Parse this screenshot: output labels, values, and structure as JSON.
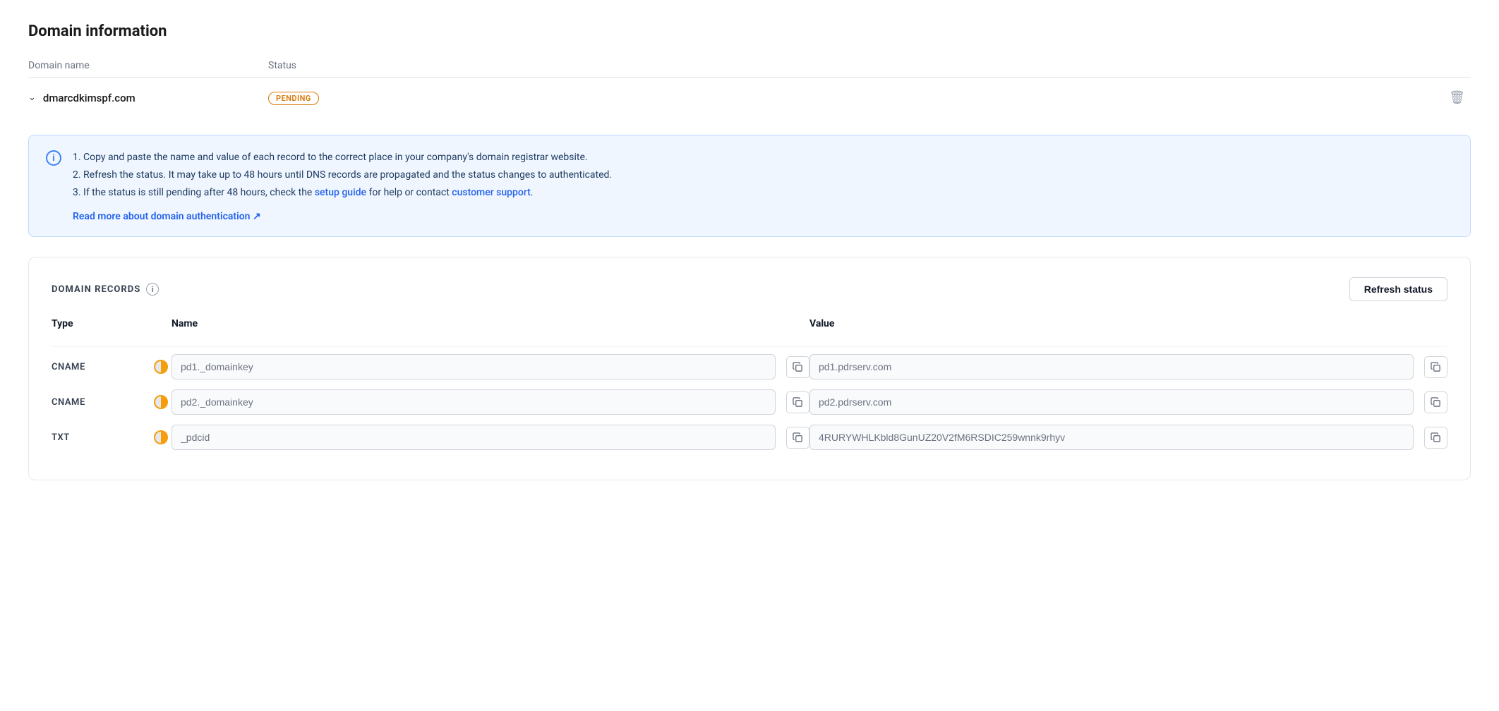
{
  "page": {
    "title": "Domain information"
  },
  "domain_table": {
    "col_name": "Domain name",
    "col_status": "Status",
    "domain": "dmarcdkimspf.com",
    "status": "PENDING"
  },
  "info_box": {
    "line1": "1. Copy and paste the name and value of each record to the correct place in your company's domain registrar website.",
    "line2": "2. Refresh the status. It may take up to 48 hours until DNS records are propagated and the status changes to authenticated.",
    "line3_pre": "3. If the status is still pending after 48 hours, check the ",
    "line3_link1": "setup guide",
    "line3_mid": " for help or contact ",
    "line3_link2": "customer support",
    "line3_post": ".",
    "read_more": "Read more about domain authentication ↗"
  },
  "domain_records": {
    "section_title": "DOMAIN RECORDS",
    "refresh_button": "Refresh status",
    "col_type": "Type",
    "col_name": "Name",
    "col_value": "Value",
    "records": [
      {
        "type": "CNAME",
        "name": "pd1._domainkey",
        "value": "pd1.pdrserv.com"
      },
      {
        "type": "CNAME",
        "name": "pd2._domainkey",
        "value": "pd2.pdrserv.com"
      },
      {
        "type": "TXT",
        "name": "_pdcid",
        "value": "4RURYWHLKbld8GunUZ20V2fM6RSDIC259wnnk9rhyv"
      }
    ]
  }
}
